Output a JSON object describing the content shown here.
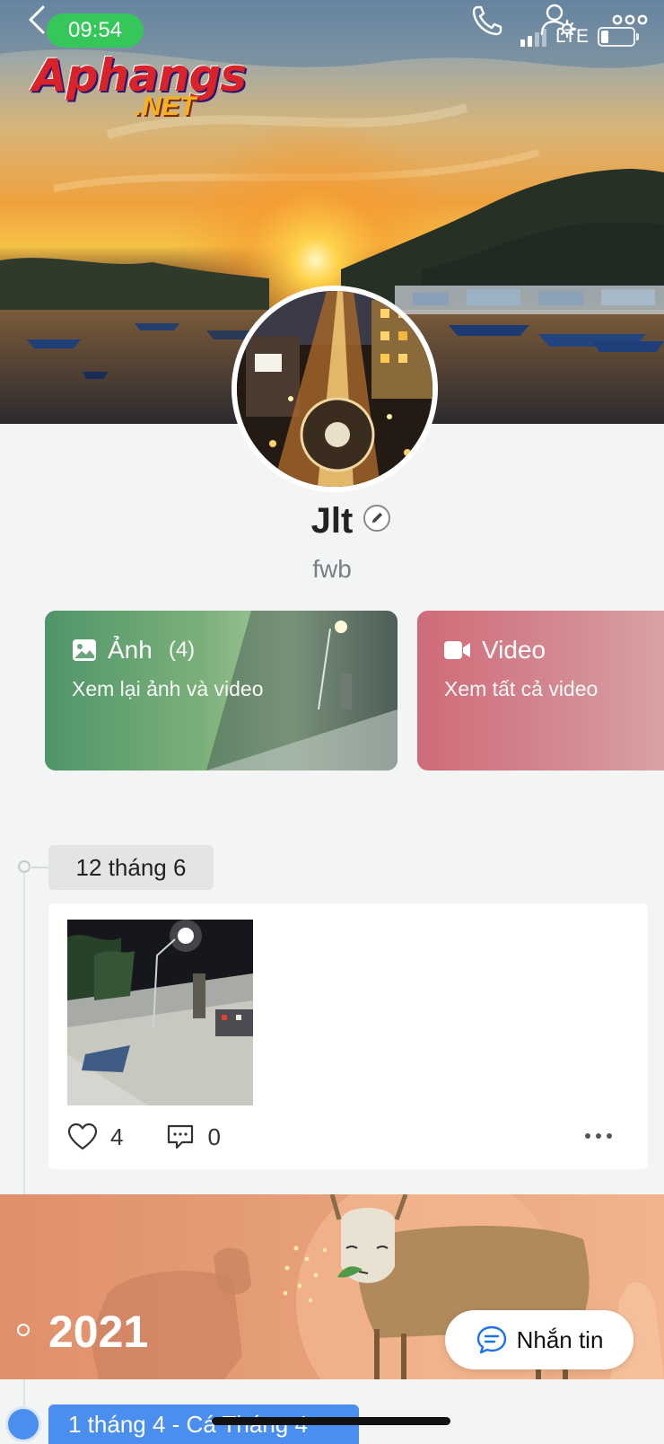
{
  "status_bar": {
    "time": "09:54",
    "network": "LTE"
  },
  "watermark": {
    "top": "Aphangs",
    "bottom": ".NET"
  },
  "profile": {
    "name": "Jlt",
    "subtitle": "fwb"
  },
  "cards": {
    "photos": {
      "title": "Ảnh",
      "count": "(4)",
      "subtitle": "Xem lại ảnh và video"
    },
    "videos": {
      "title": "Video",
      "subtitle": "Xem tất cả video"
    }
  },
  "timeline": {
    "date": "12 tháng 6",
    "post": {
      "likes": "4",
      "comments": "0"
    }
  },
  "year_banner": {
    "year": "2021"
  },
  "chat_button": {
    "label": "Nhắn tin"
  },
  "next_entry": {
    "label": "1 tháng 4 - Cá Tháng 4"
  },
  "colors": {
    "status_green": "#35c759",
    "photo_card": "#5a9b6e",
    "video_card": "#cf6b78",
    "chip_blue": "#4a8eef",
    "banner_orange": "#e6a079"
  }
}
